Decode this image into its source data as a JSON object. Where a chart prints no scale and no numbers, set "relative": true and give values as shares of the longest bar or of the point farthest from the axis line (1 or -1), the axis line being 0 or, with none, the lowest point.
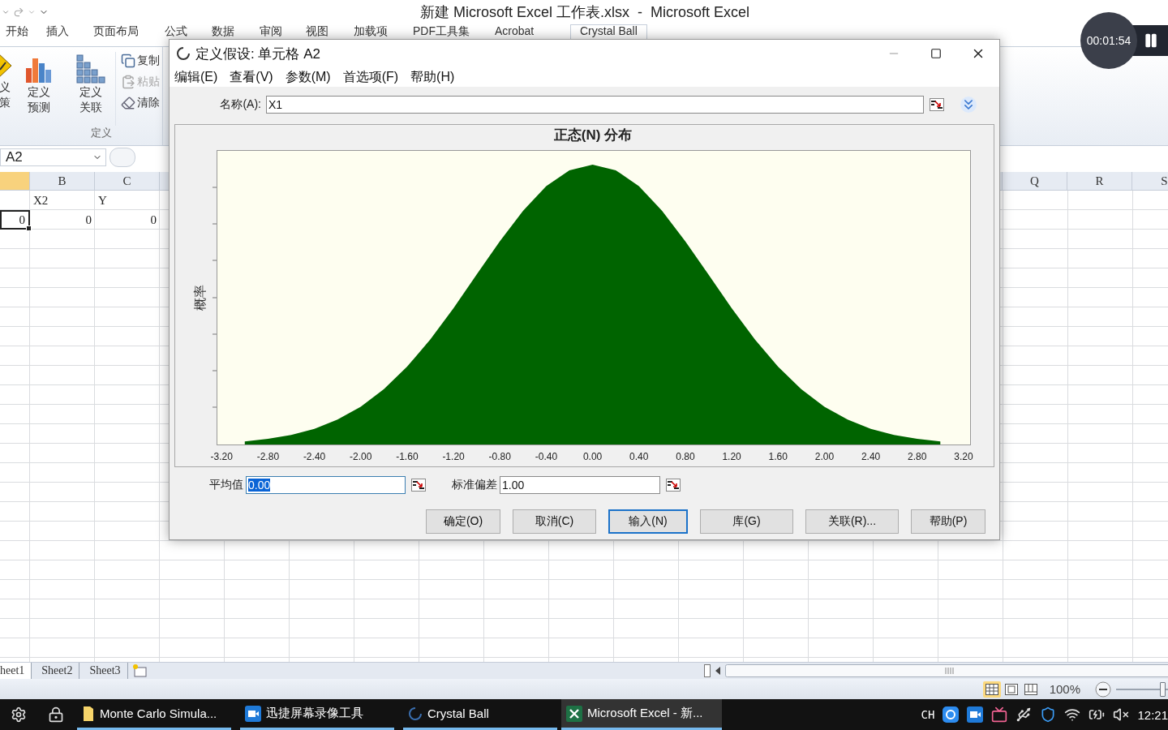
{
  "excel": {
    "title": "新建 Microsoft Excel 工作表.xlsx  -  Microsoft Excel",
    "ribbon_tabs": [
      {
        "label": "开始",
        "selected": false
      },
      {
        "label": "插入",
        "selected": false
      },
      {
        "label": "页面布局",
        "selected": false
      },
      {
        "label": "公式",
        "selected": false
      },
      {
        "label": "数据",
        "selected": false
      },
      {
        "label": "审阅",
        "selected": false
      },
      {
        "label": "视图",
        "selected": false
      },
      {
        "label": "加载项",
        "selected": false
      },
      {
        "label": "PDF工具集",
        "selected": false
      },
      {
        "label": "Acrobat",
        "selected": false
      },
      {
        "label": "Crystal Ball",
        "selected": true
      }
    ],
    "ribbon_group": {
      "label": "定义",
      "large_buttons": [
        {
          "kind": "decision",
          "lines": [
            "义",
            "策"
          ]
        },
        {
          "kind": "forecast",
          "lines": [
            "定义",
            "预测"
          ]
        },
        {
          "kind": "correlation",
          "lines": [
            "定义",
            "关联"
          ]
        }
      ],
      "small_buttons": [
        {
          "kind": "copy",
          "label": "复制",
          "disabled": false
        },
        {
          "kind": "paste",
          "label": "粘贴",
          "disabled": true
        },
        {
          "kind": "clear",
          "label": "清除",
          "disabled": false
        }
      ]
    },
    "name_box": "A2",
    "left_columns": [
      {
        "label": "B"
      },
      {
        "label": "C"
      }
    ],
    "right_columns": [
      {
        "label": "Q"
      },
      {
        "label": "R"
      },
      {
        "label": "S"
      }
    ],
    "rows": [
      {
        "cells": [
          {
            "selected": false
          },
          {
            "text": "X2",
            "selected": false
          },
          {
            "text": "Y",
            "selected": false
          }
        ]
      },
      {
        "cells": [
          {
            "text": "0",
            "selected": true
          },
          {
            "text": "0",
            "selected": false
          },
          {
            "text": "0",
            "selected": false
          }
        ]
      }
    ],
    "sheet_tabs": [
      {
        "label": "heet1",
        "selected": true
      },
      {
        "label": "Sheet2",
        "selected": false
      },
      {
        "label": "Sheet3",
        "selected": false
      }
    ],
    "zoom": {
      "label": "100%",
      "level": 0.9
    }
  },
  "dialog": {
    "title": "定义假设: 单元格 A2",
    "menu": [
      "编辑(E)",
      "查看(V)",
      "参数(M)",
      "首选项(F)",
      "帮助(H)"
    ],
    "name": {
      "label": "名称(A):",
      "value": "X1"
    },
    "chart_data": {
      "type": "area",
      "title": "正态(N) 分布",
      "ylabel": "概率",
      "relative": true,
      "xlim": [
        -3.24,
        3.26
      ],
      "xticks": [
        {
          "value": -3.2,
          "label": "-3.20"
        },
        {
          "value": -2.8,
          "label": "-2.80"
        },
        {
          "value": -2.4,
          "label": "-2.40"
        },
        {
          "value": -2.0,
          "label": "-2.00"
        },
        {
          "value": -1.6,
          "label": "-1.60"
        },
        {
          "value": -1.2,
          "label": "-1.20"
        },
        {
          "value": -0.8,
          "label": "-0.80"
        },
        {
          "value": -0.4,
          "label": "-0.40"
        },
        {
          "value": 0,
          "label": "0.00"
        },
        {
          "value": 0.4,
          "label": "0.40"
        },
        {
          "value": 0.8,
          "label": "0.80"
        },
        {
          "value": 1.2,
          "label": "1.20"
        },
        {
          "value": 1.6,
          "label": "1.60"
        },
        {
          "value": 2.0,
          "label": "2.00"
        },
        {
          "value": 2.4,
          "label": "2.40"
        },
        {
          "value": 2.8,
          "label": "2.80"
        },
        {
          "value": 3.2,
          "label": "3.20"
        }
      ],
      "x": [
        -3.0,
        -2.8,
        -2.6,
        -2.4,
        -2.2,
        -2.0,
        -1.8,
        -1.6,
        -1.4,
        -1.2,
        -1.0,
        -0.8,
        -0.6,
        -0.4,
        -0.2,
        0,
        0.2,
        0.4,
        0.6,
        0.8,
        1.0,
        1.2,
        1.4,
        1.6,
        1.8,
        2.0,
        2.2,
        2.4,
        2.6,
        2.8,
        3.0
      ],
      "series": [
        {
          "color": "#006400",
          "values": [
            0.011,
            0.02,
            0.034,
            0.056,
            0.089,
            0.135,
            0.198,
            0.278,
            0.375,
            0.487,
            0.607,
            0.726,
            0.835,
            0.923,
            0.98,
            1,
            0.98,
            0.923,
            0.835,
            0.726,
            0.607,
            0.487,
            0.375,
            0.278,
            0.198,
            0.135,
            0.089,
            0.056,
            0.034,
            0.02,
            0.011
          ]
        }
      ]
    },
    "params": [
      {
        "label": "平均值",
        "value": "0.00",
        "focused": true
      },
      {
        "label": "标准偏差",
        "value": "1.00",
        "focused": false
      }
    ],
    "buttons": [
      {
        "label": "确定(O)",
        "focused": false
      },
      {
        "label": "取消(C)",
        "focused": false
      },
      {
        "label": "输入(N)",
        "focused": true
      },
      {
        "label": "库(G)",
        "focused": false
      },
      {
        "label": "关联(R)...",
        "focused": false
      },
      {
        "label": "帮助(P)",
        "focused": false
      }
    ]
  },
  "recorder": {
    "time": "00:01:54"
  },
  "taskbar": {
    "tasks": [
      {
        "kind": "folder",
        "label": "Monte Carlo Simula...",
        "selected": false
      },
      {
        "kind": "recorder",
        "label": "迅捷屏幕录像工具",
        "selected": false
      },
      {
        "kind": "crystal",
        "label": "Crystal Ball",
        "selected": false
      },
      {
        "kind": "excel",
        "label": "Microsoft Excel - 新...",
        "selected": true
      }
    ],
    "language": "CH",
    "time": "12:21"
  }
}
